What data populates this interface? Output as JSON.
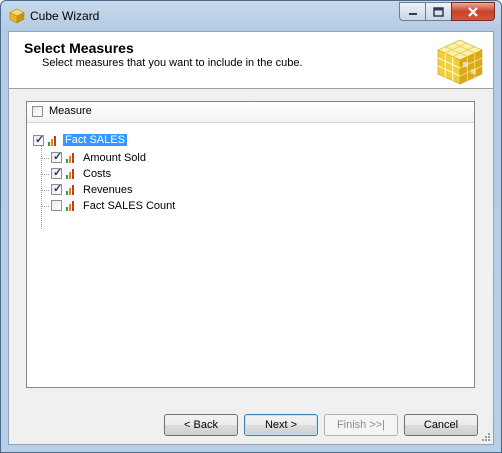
{
  "window": {
    "title": "Cube Wizard",
    "controls": {
      "minimize": "minimize",
      "maximize": "maximize",
      "close": "close"
    }
  },
  "header": {
    "title": "Select Measures",
    "subtitle": "Select measures that you want to include in the cube."
  },
  "tree": {
    "column_header": {
      "label": "Measure",
      "checked": false
    },
    "root": {
      "label": "Fact SALES",
      "checked": true,
      "selected": true,
      "icon": "measure-group-icon"
    },
    "children": [
      {
        "label": "Amount Sold",
        "checked": true,
        "icon": "measure-icon"
      },
      {
        "label": "Costs",
        "checked": true,
        "icon": "measure-icon"
      },
      {
        "label": "Revenues",
        "checked": true,
        "icon": "measure-icon"
      },
      {
        "label": "Fact SALES Count",
        "checked": false,
        "icon": "measure-icon"
      }
    ]
  },
  "buttons": {
    "back": "< Back",
    "next": "Next >",
    "finish": "Finish >>|",
    "cancel": "Cancel"
  },
  "colors": {
    "selection": "#3399ff",
    "bar_green": "#3aa02c",
    "bar_orange": "#e08a16",
    "bar_red": "#c83a1e"
  }
}
